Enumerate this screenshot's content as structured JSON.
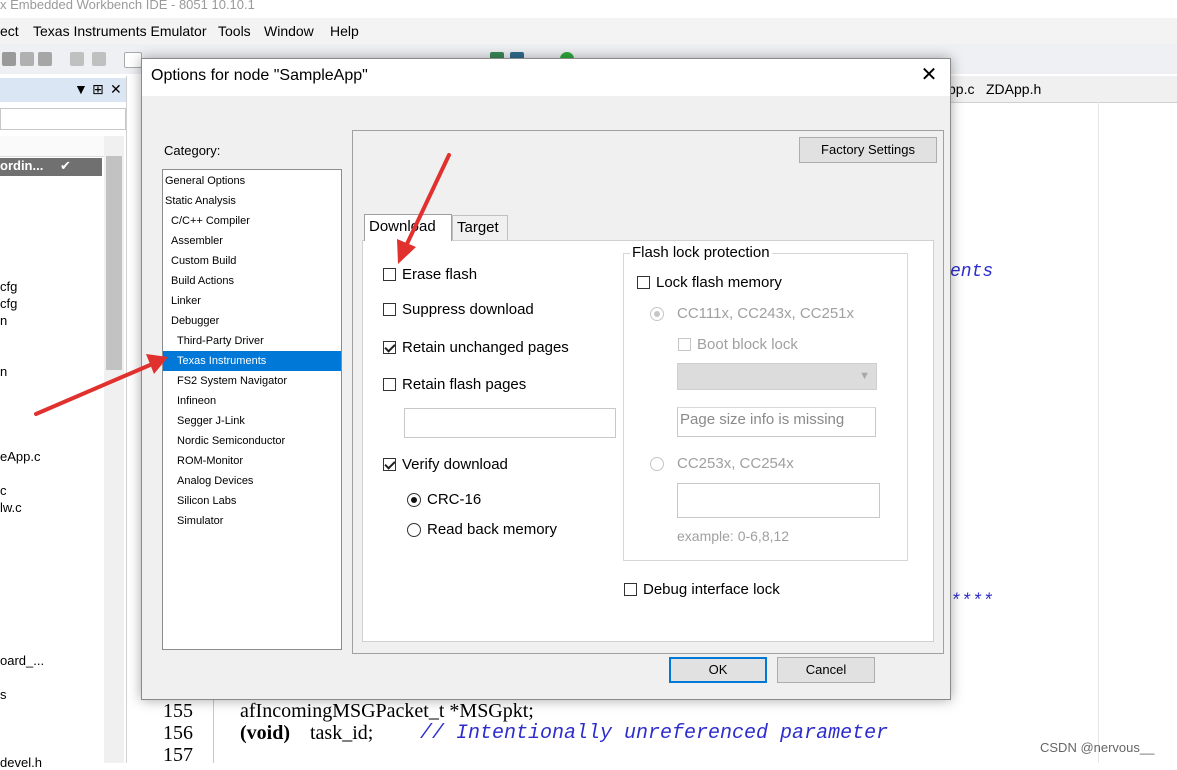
{
  "window": {
    "title_fragment": "x Embedded Workbench IDE - 8051 10.10.1"
  },
  "menu": [
    "ect",
    "Texas Instruments Emulator",
    "Tools",
    "Window",
    "Help"
  ],
  "left_pane": {
    "pin_icons": [
      "▼",
      "⊞",
      "✕"
    ],
    "selected_row": "ordin...",
    "rows": [
      "cfg",
      "cfg",
      "n",
      "n",
      "eApp.c",
      "c",
      "lw.c",
      "oard_...",
      "s",
      "devel.h"
    ]
  },
  "editor": {
    "tabs": [
      "pp.c",
      "ZDApp.h"
    ],
    "side_fragments": [
      "ents",
      "****"
    ],
    "lines": [
      {
        "num": "155",
        "code": "afIncomingMSGPacket_t *MSGpkt;"
      },
      {
        "num": "156",
        "code_kw": "(void)",
        "code_rest": "task_id;",
        "comment": "// Intentionally unreferenced parameter"
      },
      {
        "num": "157",
        "code": ""
      }
    ]
  },
  "dialog": {
    "title": "Options for node \"SampleApp\"",
    "category_label": "Category:",
    "categories": [
      "General Options",
      "Static Analysis",
      "C/C++ Compiler",
      "Assembler",
      "Custom Build",
      "Build Actions",
      "Linker",
      "Debugger",
      "Third-Party Driver",
      "Texas Instruments",
      "FS2 System Navigator",
      "Infineon",
      "Segger J-Link",
      "Nordic Semiconductor",
      "ROM-Monitor",
      "Analog Devices",
      "Silicon Labs",
      "Simulator"
    ],
    "selected_category": "Texas Instruments",
    "factory_settings": "Factory Settings",
    "tabs": [
      "Download",
      "Target"
    ],
    "download": {
      "erase_flash": "Erase flash",
      "suppress_download": "Suppress download",
      "retain_unchanged": "Retain unchanged  pages",
      "retain_flash": "Retain flash pages",
      "retain_flash_value": "",
      "verify_download": "Verify download",
      "crc16": "CRC-16",
      "read_back": "Read back memory"
    },
    "flash_lock": {
      "title": "Flash lock protection",
      "lock_flash_memory": "Lock flash memory",
      "cc111x": "CC111x, CC243x, CC251x",
      "boot_block_lock": "Boot block lock",
      "page_size_info": "Page size info is missing",
      "cc253x": "CC253x, CC254x",
      "pages_value": "",
      "example": "example: 0-6,8,12"
    },
    "debug_interface_lock": "Debug interface lock",
    "ok": "OK",
    "cancel": "Cancel"
  },
  "watermark": "CSDN @nervous__",
  "colors": {
    "selection": "#0078d7",
    "annotation_arrow": "#e0312f",
    "comment": "#2d2dcc"
  }
}
